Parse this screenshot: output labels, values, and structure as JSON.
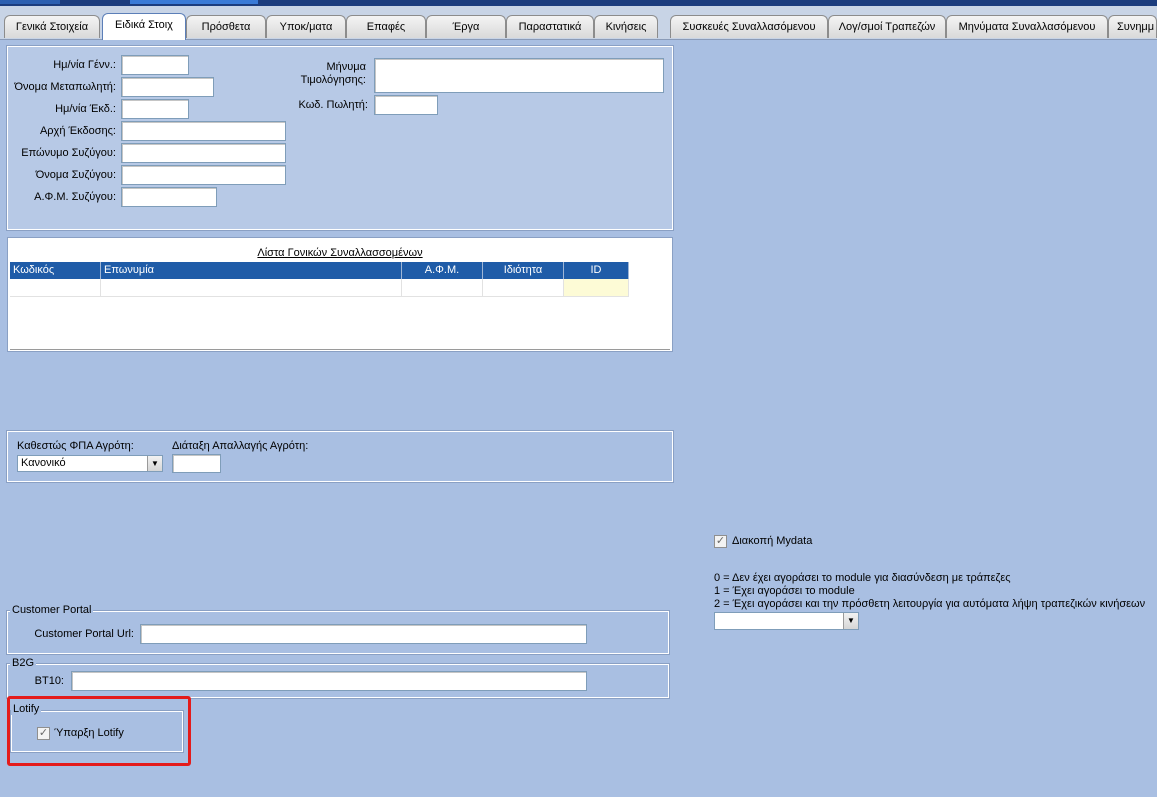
{
  "tabs": [
    {
      "label": "Γενικά Στοιχεία",
      "active": false
    },
    {
      "label": "Ειδικά Στοιχ",
      "active": true
    },
    {
      "label": "Πρόσθετα",
      "active": false
    },
    {
      "label": "Υποκ/ματα",
      "active": false
    },
    {
      "label": "Επαφές",
      "active": false
    },
    {
      "label": "Έργα",
      "active": false
    },
    {
      "label": "Παραστατικά",
      "active": false
    },
    {
      "label": "Κινήσεις",
      "active": false
    },
    {
      "label": "Συσκευές Συναλλασόμενου",
      "active": false
    },
    {
      "label": "Λογ/σμοί Τραπεζών",
      "active": false
    },
    {
      "label": "Μηνύματα Συναλλασόμενου",
      "active": false
    },
    {
      "label": "Συνημμ",
      "active": false
    }
  ],
  "personal": {
    "birth_date_label": "Ημ/νία Γένν.:",
    "reseller_name_label": "Όνομα Μεταπωλητή:",
    "issue_date_label": "Ημ/νία Έκδ.:",
    "issuing_authority_label": "Αρχή Έκδοσης:",
    "spouse_surname_label": "Επώνυμο Συζύγου:",
    "spouse_name_label": "Όνομα Συζύγου:",
    "spouse_vat_label": "Α.Φ.Μ. Συζύγου:",
    "invoice_message_label": "Μήνυμα Τιμολόγησης:",
    "seller_code_label": "Κωδ. Πωλητή:"
  },
  "parents_list": {
    "title": "Λίστα Γονικών Συναλλασσομένων",
    "columns": [
      "Κωδικός",
      "Επωνυμία",
      "Α.Φ.Μ.",
      "Ιδιότητα",
      "ID"
    ]
  },
  "farmer": {
    "vat_status_label": "Καθεστώς ΦΠΑ Αγρότη:",
    "vat_status_value": "Κανονικό",
    "exemption_label": "Διάταξη Απαλλαγής Αγρότη:"
  },
  "customer_portal": {
    "group_title": "Customer Portal",
    "url_label": "Customer Portal Url:"
  },
  "b2g": {
    "group_title": "B2G",
    "bt10_label": "BT10:"
  },
  "lotify": {
    "group_title": "Lotify",
    "checkbox_label": "Ύπαρξη Lotify",
    "checked": true
  },
  "mydata": {
    "checkbox_label": "Διακοπή Mydata",
    "checked": true,
    "legend_0": "0 = Δεν έχει αγοράσει το module για διασύνδεση με τράπεζες",
    "legend_1": "1 = Έχει αγοράσει το module",
    "legend_2": "2 = Έχει αγοράσει και την πρόσθετη λειτουργία για αυτόματα λήψη τραπεζικών κινήσεων",
    "select_value": ""
  },
  "icons": {
    "check": "✓",
    "dropdown": "▼"
  }
}
